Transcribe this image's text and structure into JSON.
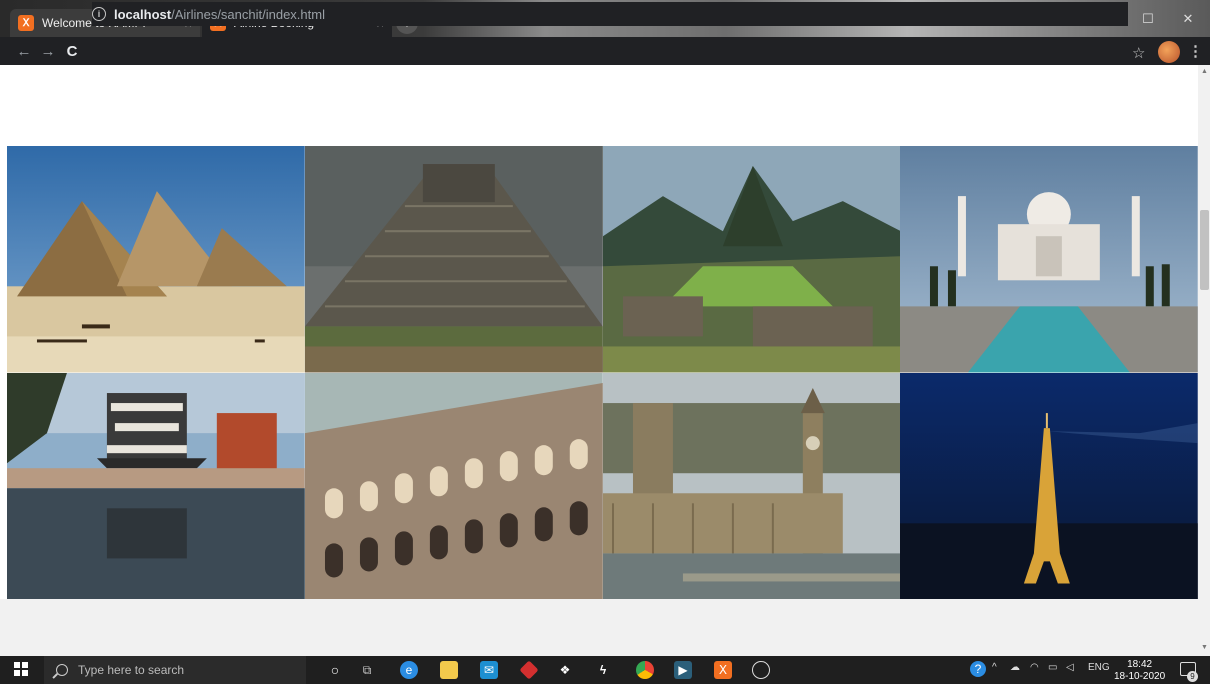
{
  "browser": {
    "tabs": [
      {
        "label": "Welcome to XAMPP",
        "close": "×",
        "favicon": "xampp-icon"
      },
      {
        "label": "Airline Booking",
        "close": "×",
        "favicon": "xampp-icon"
      }
    ],
    "new_tab": "+",
    "url_host": "localhost",
    "url_path": "/Airlines/sanchit/index.html",
    "info_glyph": "i",
    "back": "←",
    "forward": "→",
    "reload": "C",
    "star": "☆",
    "menu": "⋮",
    "window_controls": [
      "—",
      "☐",
      "✕"
    ]
  },
  "gallery": {
    "photos": [
      {
        "name": "pyramids-giza-photo"
      },
      {
        "name": "chichen-itza-photo"
      },
      {
        "name": "machu-picchu-photo"
      },
      {
        "name": "taj-mahal-photo"
      },
      {
        "name": "matsumoto-castle-photo"
      },
      {
        "name": "colosseum-photo"
      },
      {
        "name": "westminster-photo"
      },
      {
        "name": "eiffel-tower-photo"
      }
    ]
  },
  "taskbar": {
    "search_placeholder": "Type here to search",
    "language": "ENG",
    "time": "18:42",
    "date": "18-10-2020",
    "notification_count": "9"
  },
  "colors": {
    "chrome_dark": "#202124",
    "taskbar": "#1f1f1f",
    "xampp_orange": "#f26f21"
  }
}
